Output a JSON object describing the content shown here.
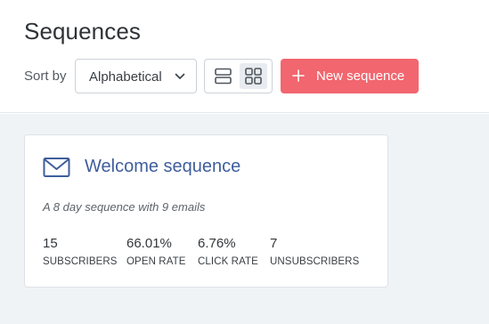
{
  "header": {
    "title": "Sequences",
    "sort_label": "Sort by",
    "sort_value": "Alphabetical",
    "new_button_label": "New sequence",
    "active_view": "grid"
  },
  "sequences": [
    {
      "title": "Welcome sequence",
      "description": "A 8 day sequence with 9 emails",
      "stats": [
        {
          "value": "15",
          "label": "SUBSCRIBERS"
        },
        {
          "value": "66.01%",
          "label": "OPEN RATE"
        },
        {
          "value": "6.76%",
          "label": "CLICK RATE"
        },
        {
          "value": "7",
          "label": "UNSUBSCRIBERS"
        }
      ]
    }
  ],
  "colors": {
    "accent": "#f1666f",
    "link": "#3f5e9b",
    "background": "#f0f3f6"
  },
  "icons": {
    "sort_chevron": "chevron-down-icon",
    "list_view": "list-view-icon",
    "grid_view": "grid-view-icon",
    "new": "plus-icon",
    "sequence": "mail-icon"
  }
}
